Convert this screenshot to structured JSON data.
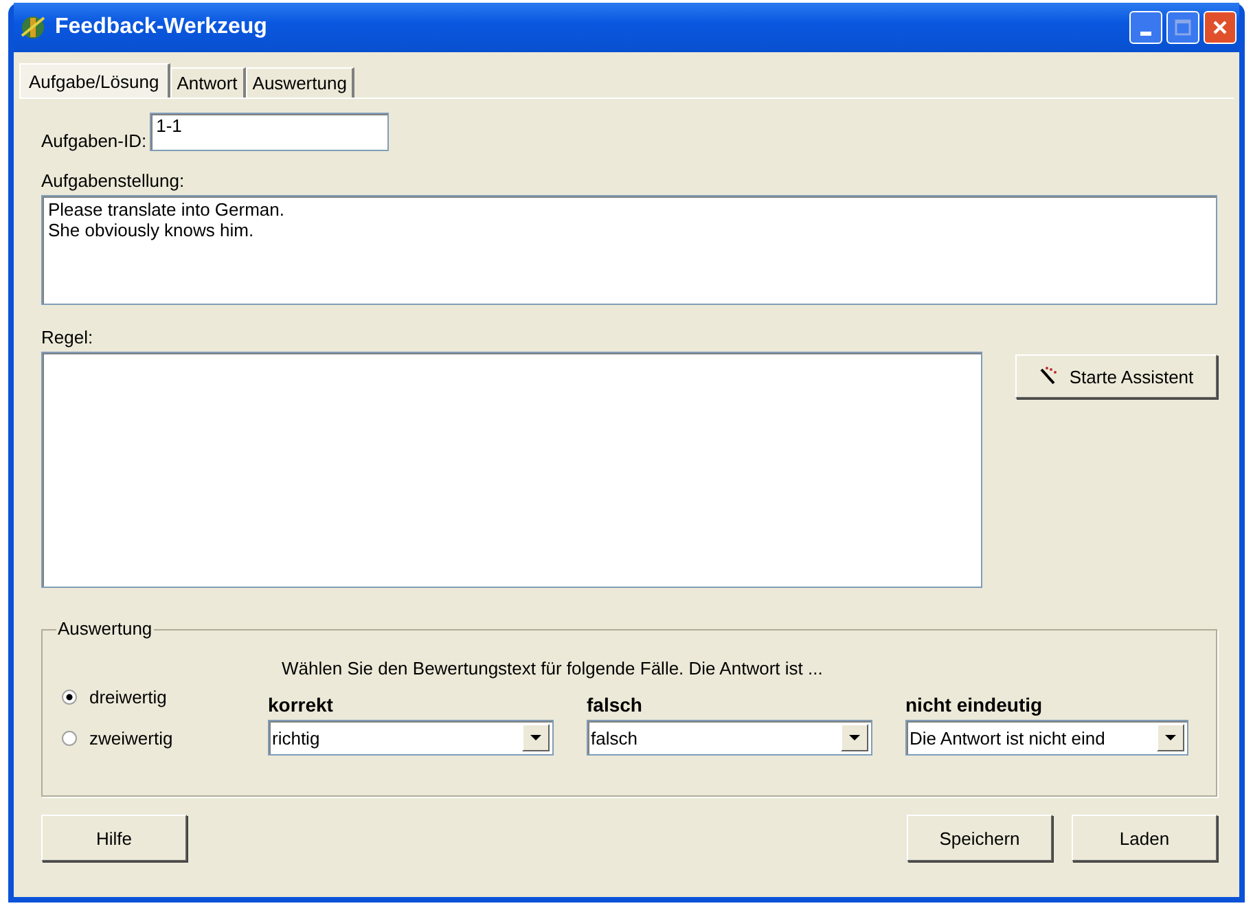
{
  "window": {
    "title": "Feedback-Werkzeug"
  },
  "tabs": [
    {
      "label": "Aufgabe/Lösung",
      "selected": true
    },
    {
      "label": "Antwort",
      "selected": false
    },
    {
      "label": "Auswertung",
      "selected": false
    }
  ],
  "task_id": {
    "label": "Aufgaben-ID:",
    "value": "1-1"
  },
  "task": {
    "label": "Aufgabenstellung:",
    "value": "Please translate into German.\nShe obviously knows him."
  },
  "rule": {
    "label": "Regel:"
  },
  "assistant_button": "Starte Assistent",
  "evaluation": {
    "title": "Auswertung",
    "instruction": "Wählen Sie den Bewertungstext für folgende Fälle. Die Antwort ist ...",
    "modes": [
      {
        "label": "dreiwertig",
        "selected": true
      },
      {
        "label": "zweiwertig",
        "selected": false
      }
    ],
    "cases": [
      {
        "label": "korrekt",
        "value": "richtig"
      },
      {
        "label": "falsch",
        "value": "falsch"
      },
      {
        "label": "nicht eindeutig",
        "value": "Die Antwort ist nicht eind"
      }
    ]
  },
  "buttons": {
    "help": "Hilfe",
    "save": "Speichern",
    "load": "Laden"
  }
}
